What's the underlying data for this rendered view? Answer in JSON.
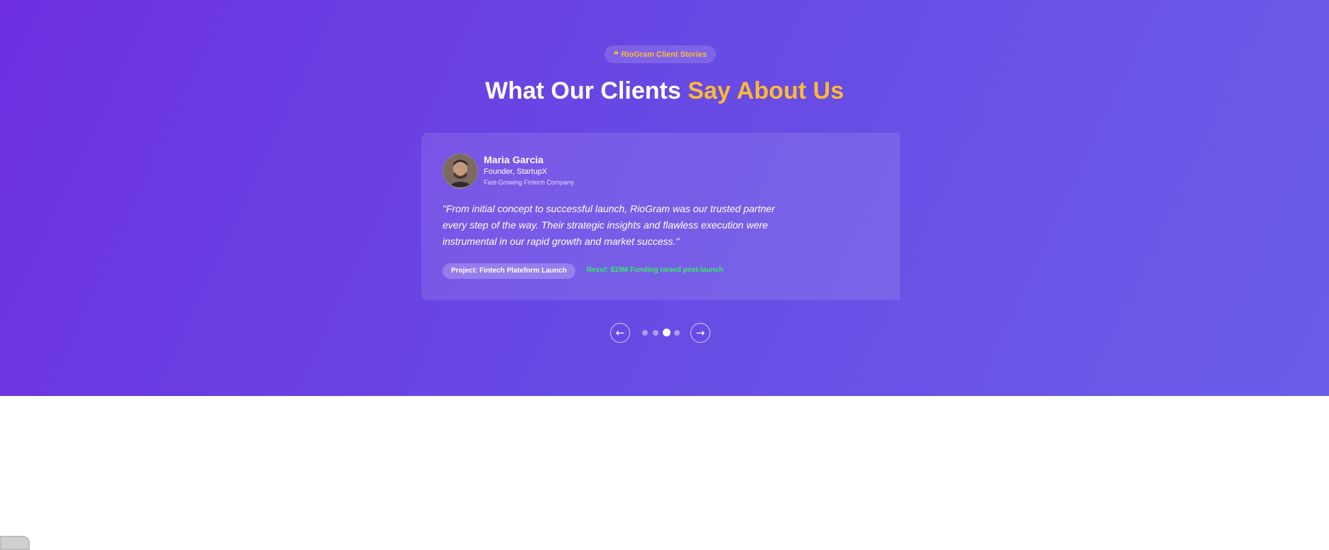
{
  "section": {
    "badge_icon": "quote-icon",
    "badge_label": "RioGram Client Stories",
    "heading_main": "What Our Clients ",
    "heading_accent": "Say About Us",
    "accent_color": "#fbb936"
  },
  "testimonial": {
    "name": "Maria Garcia",
    "role": "Founder, StartupX",
    "company": "Fast-Growing Fintech Company",
    "quote": "\"From initial concept to successful launch, RioGram was our trusted partner every step of the way. Their strategic insights and flawless execution were instrumental in our rapid growth and market success.\"",
    "project": "Project: Fintech Plateform Launch",
    "result": "Resul: $10M Funding raised post-launch",
    "result_color": "#33ee66"
  },
  "carousel": {
    "prev_icon": "arrow-left-icon",
    "prev_symbol": "←",
    "next_icon": "arrow-right-icon",
    "next_symbol": "→",
    "slide_count": 4,
    "active_index": 2
  }
}
